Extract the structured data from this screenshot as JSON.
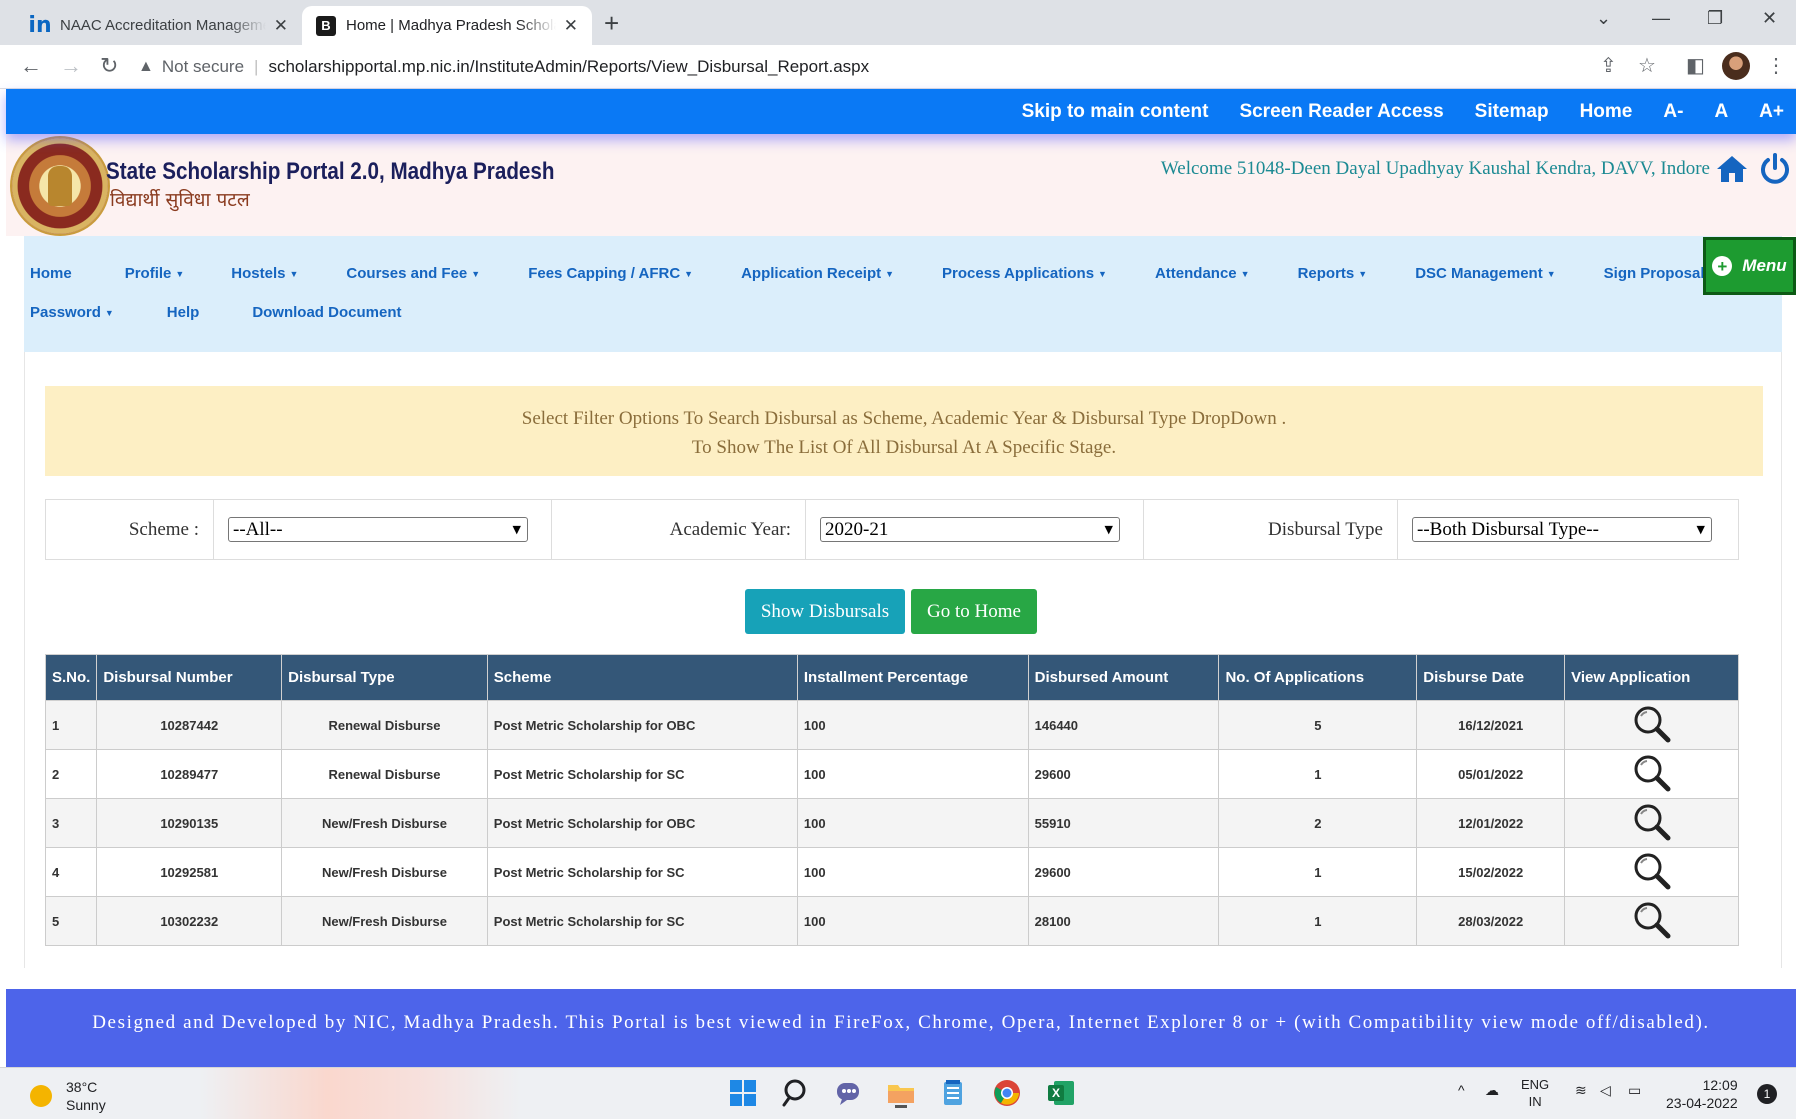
{
  "browser": {
    "tabs": [
      {
        "favicon": "in",
        "title": "NAAC Accreditation Management",
        "active": false
      },
      {
        "favicon": "B",
        "title": "Home | Madhya Pradesh Scholarship",
        "active": true
      }
    ],
    "security_label": "Not secure",
    "url": "scholarshipportal.mp.nic.in/InstituteAdmin/Reports/View_Disbursal_Report.aspx"
  },
  "utility_nav": {
    "skip": "Skip to main content",
    "screen_reader": "Screen Reader Access",
    "sitemap": "Sitemap",
    "home": "Home",
    "font_minus": "A-",
    "font_normal": "A",
    "font_plus": "A+"
  },
  "header": {
    "title": "State Scholarship Portal 2.0, Madhya Pradesh",
    "subtitle": "विद्यार्थी सुविधा पटल",
    "welcome": "Welcome 51048-Deen Dayal Upadhyay Kaushal Kendra, DAVV, Indore"
  },
  "nav": {
    "home": "Home",
    "profile": "Profile",
    "hostels": "Hostels",
    "courses": "Courses and Fee",
    "fees_capping": "Fees Capping / AFRC",
    "application_receipt": "Application Receipt",
    "process_applications": "Process Applications",
    "attendance": "Attendance",
    "reports": "Reports",
    "dsc": "DSC Management",
    "sign_proposals": "Sign Proposals Digitally",
    "password": "Password",
    "help": "Help",
    "download": "Download Document",
    "menu_button": "Menu"
  },
  "alert": {
    "line1": "Select Filter Options To Search Disbursal as Scheme, Academic Year & Disbursal Type DropDown .",
    "line2": "To Show The List Of All Disbursal At A Specific Stage."
  },
  "filters": {
    "scheme_label": "Scheme :",
    "scheme_value": "--All--",
    "year_label": "Academic Year:",
    "year_value": "2020-21",
    "type_label": "Disbursal Type",
    "type_value": "--Both Disbursal Type--"
  },
  "buttons": {
    "show": "Show Disbursals",
    "home": "Go to Home"
  },
  "table": {
    "headers": {
      "sno": "S.No.",
      "number": "Disbursal Number",
      "type": "Disbursal Type",
      "scheme": "Scheme",
      "installment": "Installment Percentage",
      "amount": "Disbursed Amount",
      "apps": "No. Of Applications",
      "date": "Disburse Date",
      "view": "View Application"
    },
    "rows": [
      {
        "sno": "1",
        "number": "10287442",
        "type": "Renewal Disburse",
        "scheme": "Post Metric Scholarship for OBC",
        "installment": "100",
        "amount": "146440",
        "apps": "5",
        "date": "16/12/2021"
      },
      {
        "sno": "2",
        "number": "10289477",
        "type": "Renewal Disburse",
        "scheme": "Post Metric Scholarship for SC",
        "installment": "100",
        "amount": "29600",
        "apps": "1",
        "date": "05/01/2022"
      },
      {
        "sno": "3",
        "number": "10290135",
        "type": "New/Fresh Disburse",
        "scheme": "Post Metric Scholarship for OBC",
        "installment": "100",
        "amount": "55910",
        "apps": "2",
        "date": "12/01/2022"
      },
      {
        "sno": "4",
        "number": "10292581",
        "type": "New/Fresh Disburse",
        "scheme": "Post Metric Scholarship for SC",
        "installment": "100",
        "amount": "29600",
        "apps": "1",
        "date": "15/02/2022"
      },
      {
        "sno": "5",
        "number": "10302232",
        "type": "New/Fresh Disburse",
        "scheme": "Post Metric Scholarship for SC",
        "installment": "100",
        "amount": "28100",
        "apps": "1",
        "date": "28/03/2022"
      }
    ]
  },
  "footer": {
    "text": "Designed and Developed by NIC, Madhya Pradesh. This Portal is best viewed in FireFox, Chrome, Opera, Internet Explorer 8 or + (with Compatibility view mode off/disabled)."
  },
  "taskbar": {
    "temperature": "38°C",
    "weather": "Sunny",
    "lang": "ENG",
    "region": "IN",
    "time": "12:09",
    "date": "23-04-2022",
    "notifications": "1"
  },
  "colors": {
    "utility_bar": "#0a79f5",
    "nav_background": "#dbeefb",
    "table_header": "#345778",
    "show_button": "#17a2b8",
    "home_button": "#28a745",
    "footer": "#4d64ea"
  }
}
